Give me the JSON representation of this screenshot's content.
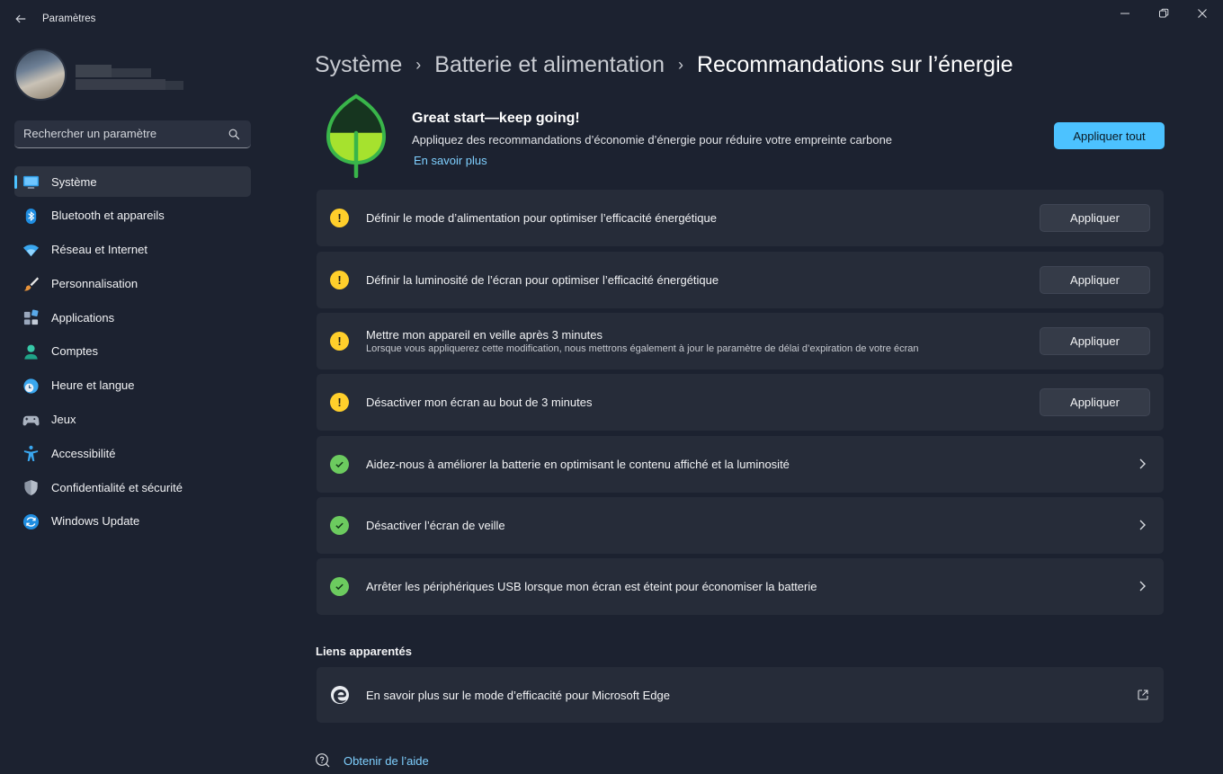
{
  "window": {
    "title": "Paramètres",
    "back_icon": "back-arrow-icon",
    "controls": [
      "minimize-icon",
      "restore-icon",
      "close-icon"
    ]
  },
  "search": {
    "placeholder": "Rechercher un paramètre",
    "value": ""
  },
  "sidebar": {
    "items": [
      {
        "label": "Système",
        "icon": "system-icon",
        "active": true
      },
      {
        "label": "Bluetooth et appareils",
        "icon": "bluetooth-icon"
      },
      {
        "label": "Réseau et Internet",
        "icon": "wifi-icon"
      },
      {
        "label": "Personnalisation",
        "icon": "brush-icon"
      },
      {
        "label": "Applications",
        "icon": "apps-icon"
      },
      {
        "label": "Comptes",
        "icon": "account-icon"
      },
      {
        "label": "Heure et langue",
        "icon": "clock-globe-icon"
      },
      {
        "label": "Jeux",
        "icon": "gamepad-icon"
      },
      {
        "label": "Accessibilité",
        "icon": "accessibility-icon"
      },
      {
        "label": "Confidentialité et sécurité",
        "icon": "shield-icon"
      },
      {
        "label": "Windows Update",
        "icon": "update-icon"
      }
    ]
  },
  "breadcrumb": {
    "items": [
      "Système",
      "Batterie et alimentation",
      "Recommandations sur l’énergie"
    ],
    "separator": "›"
  },
  "hero": {
    "title": "Great start—keep going!",
    "subtitle": "Appliquez des recommandations d’économie d’énergie pour réduire votre empreinte carbone",
    "link": "En savoir plus",
    "apply_all": "Appliquer tout",
    "icon": "leaf-icon",
    "progress_fraction": 0.45
  },
  "recommendations": [
    {
      "status": "warning",
      "label": "Définir le mode d’alimentation pour optimiser l’efficacité énergétique",
      "action": "Appliquer"
    },
    {
      "status": "warning",
      "label": "Définir la luminosité de l’écran pour optimiser l’efficacité énergétique",
      "action": "Appliquer"
    },
    {
      "status": "warning",
      "label": "Mettre mon appareil en veille après 3 minutes",
      "description": "Lorsque vous appliquerez cette modification, nous mettrons également à jour le paramètre de délai d’expiration de votre écran",
      "action": "Appliquer"
    },
    {
      "status": "warning",
      "label": "Désactiver mon écran au bout de 3 minutes",
      "action": "Appliquer"
    },
    {
      "status": "done",
      "label": "Aidez-nous à améliorer la batterie en optimisant le contenu affiché et la luminosité"
    },
    {
      "status": "done",
      "label": "Désactiver l’écran de veille"
    },
    {
      "status": "done",
      "label": "Arrêter les périphériques USB lorsque mon écran est éteint pour économiser la batterie"
    }
  ],
  "related": {
    "title": "Liens apparentés",
    "link_label": "En savoir plus sur le mode d’efficacité pour Microsoft Edge",
    "link_icon": "edge-icon"
  },
  "help": {
    "label": "Obtenir de l’aide",
    "icon": "help-icon"
  },
  "colors": {
    "accent": "#4cc2ff",
    "warning": "#ffcf2b",
    "success": "#6ccb5f",
    "background": "#1c2230",
    "card": "#262c39"
  }
}
